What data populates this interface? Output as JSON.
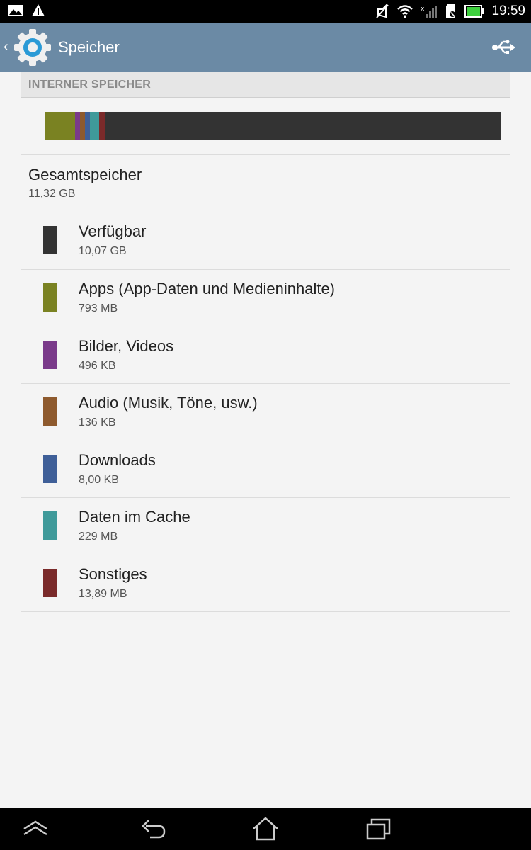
{
  "status_bar": {
    "time": "19:59",
    "left_icons": [
      "image-notification-icon",
      "warning-icon"
    ],
    "right_icons": [
      "mute-icon",
      "wifi-icon",
      "no-signal-icon",
      "sd-card-icon",
      "battery-icon"
    ]
  },
  "action_bar": {
    "title": "Speicher",
    "icon": "settings-gear-icon",
    "action_icon": "usb-icon"
  },
  "section": {
    "header": "INTERNER SPEICHER"
  },
  "usage_bar": {
    "segments": [
      {
        "name": "apps",
        "color": "#7a8222",
        "fraction": 0.067
      },
      {
        "name": "images",
        "color": "#7a3a8a",
        "fraction": 0.011
      },
      {
        "name": "audio",
        "color": "#8e5a2e",
        "fraction": 0.011
      },
      {
        "name": "downloads",
        "color": "#3f5f98",
        "fraction": 0.011
      },
      {
        "name": "cache",
        "color": "#3f9a9a",
        "fraction": 0.02
      },
      {
        "name": "other",
        "color": "#7a2a2a",
        "fraction": 0.012
      }
    ],
    "background": "#333333"
  },
  "total": {
    "title": "Gesamtspeicher",
    "value": "11,32 GB"
  },
  "items": [
    {
      "title": "Verfügbar",
      "value": "10,07 GB",
      "color": "#333333"
    },
    {
      "title": "Apps (App-Daten und Medieninhalte)",
      "value": "793 MB",
      "color": "#7a8222"
    },
    {
      "title": "Bilder, Videos",
      "value": "496 KB",
      "color": "#7a3a8a"
    },
    {
      "title": "Audio (Musik, Töne, usw.)",
      "value": "136 KB",
      "color": "#8e5a2e"
    },
    {
      "title": "Downloads",
      "value": "8,00 KB",
      "color": "#3f5f98"
    },
    {
      "title": "Daten im Cache",
      "value": "229 MB",
      "color": "#3f9a9a"
    },
    {
      "title": "Sonstiges",
      "value": "13,89 MB",
      "color": "#7a2a2a"
    }
  ],
  "nav_bar": {
    "buttons": [
      "menu-up-icon",
      "back-icon",
      "home-icon",
      "recents-icon"
    ]
  }
}
